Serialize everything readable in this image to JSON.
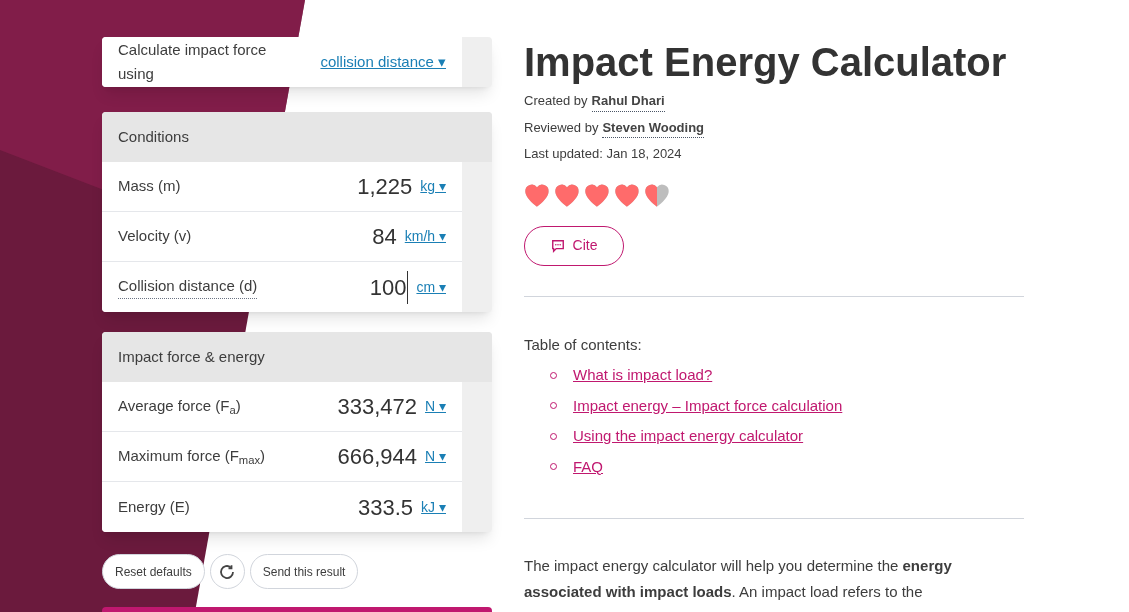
{
  "mode_selector": {
    "label": "Calculate impact force using",
    "value": "collision distance",
    "caret": "▾"
  },
  "conditions": {
    "title": "Conditions",
    "rows": [
      {
        "label": "Mass (m)",
        "value": "1,225",
        "unit": "kg",
        "caret": "▾",
        "dotted": false,
        "focused": false
      },
      {
        "label": "Velocity (v)",
        "value": "84",
        "unit": "km/h",
        "caret": "▾",
        "dotted": false,
        "focused": false
      },
      {
        "label": "Collision distance (d)",
        "value": "100",
        "unit": "cm",
        "caret": "▾",
        "dotted": true,
        "focused": true
      }
    ]
  },
  "results": {
    "title": "Impact force & energy",
    "rows": [
      {
        "label": "Average force (F$_{a}$)",
        "value": "333,472",
        "unit": "N",
        "caret": "▾"
      },
      {
        "label": "Maximum force (F$_{max}$)",
        "value": "666,944",
        "unit": "N",
        "caret": "▾"
      },
      {
        "label": "Energy (E)",
        "value": "333.5",
        "unit": "kJ",
        "caret": "▾"
      }
    ]
  },
  "actions": {
    "reset": "Reset defaults",
    "send": "Send this result"
  },
  "article": {
    "title": "Impact Energy Calculator",
    "byline": [
      {
        "prefix": "Created by",
        "name": "Rahul Dhari"
      },
      {
        "prefix": "Reviewed by",
        "name": "Steven Wooding"
      }
    ],
    "updated": "Last updated: Jan 18, 2024",
    "rating": {
      "stars": 4.5
    },
    "cite": "Cite",
    "toc": {
      "heading": "Table of contents:",
      "items": [
        "What is impact load?",
        "Impact energy – Impact force calculation",
        "Using the impact energy calculator",
        "FAQ"
      ]
    },
    "intro": "The impact energy calculator will help you determine the **energy associated with impact loads**. An impact load refers to the"
  }
}
